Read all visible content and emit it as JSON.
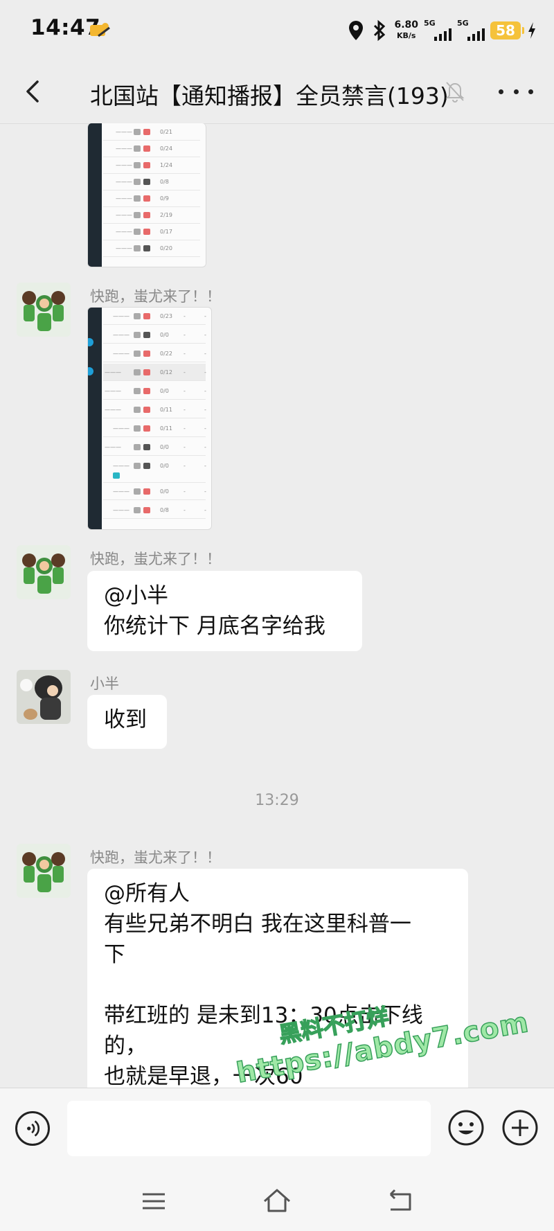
{
  "status_bar": {
    "time": "14:47",
    "net_speed_value": "6.80",
    "net_speed_unit": "KB/s",
    "network_1": "5G",
    "network_2": "5G",
    "battery": "58",
    "icons": [
      "notification-app-icon",
      "location-icon",
      "bluetooth-icon",
      "signal-icon",
      "signal-icon",
      "battery-icon",
      "charging-icon"
    ]
  },
  "header": {
    "title": "北国站【通知播报】全员禁言(193)",
    "icons": [
      "back-icon",
      "mute-bell-icon",
      "more-icon"
    ]
  },
  "messages": [
    {
      "type": "image",
      "sender": "",
      "description": "screenshot-partial"
    },
    {
      "type": "image",
      "sender": "快跑，蚩尤来了！！",
      "description": "screenshot"
    },
    {
      "type": "text",
      "sender": "快跑，蚩尤来了！！",
      "lines": [
        "@小半",
        "你统计下 月底名字给我"
      ]
    },
    {
      "type": "text",
      "sender": "小半",
      "lines": [
        "收到"
      ]
    },
    {
      "type": "text",
      "sender": "快跑，蚩尤来了！！",
      "lines": [
        "@所有人",
        "有些兄弟不明白 我在这里科普一",
        "下",
        "",
        "带红班的 是未到13：30点击下线",
        "的，",
        "也就是早退，一次60"
      ]
    }
  ],
  "timestamp": "13:29",
  "input_bar": {
    "placeholder": "",
    "icons": [
      "voice-icon",
      "emoji-icon",
      "plus-icon"
    ]
  },
  "nav_bar": {
    "icons": [
      "menu-icon",
      "home-icon",
      "back-nav-icon"
    ]
  },
  "watermark": {
    "line1": "黑料不打烊",
    "line2": "https://abdy7.com"
  }
}
